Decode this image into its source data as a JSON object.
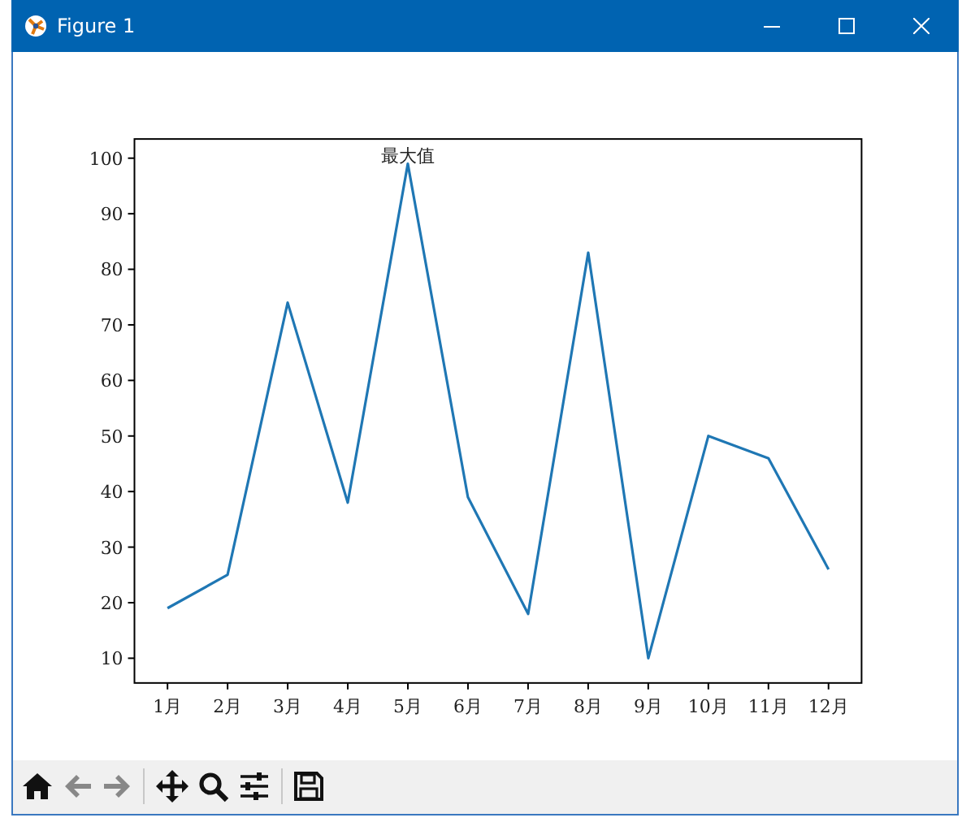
{
  "window": {
    "title": "Figure 1"
  },
  "chart_data": {
    "type": "line",
    "categories": [
      "1月",
      "2月",
      "3月",
      "4月",
      "5月",
      "6月",
      "7月",
      "8月",
      "9月",
      "10月",
      "11月",
      "12月"
    ],
    "series": [
      {
        "color": "#1f77b4",
        "values": [
          19,
          25,
          74,
          38,
          99,
          39,
          18,
          83,
          10,
          50,
          46,
          26
        ]
      }
    ],
    "ylim": [
      5.55,
      103.45
    ],
    "yticks": [
      10,
      20,
      30,
      40,
      50,
      60,
      70,
      80,
      90,
      100
    ],
    "annotations": [
      {
        "x": "5月",
        "y": 100,
        "text": "最大值"
      }
    ]
  },
  "toolbar": [
    {
      "buttons": [
        {
          "kind": "home",
          "disabled": false
        },
        {
          "kind": "back",
          "disabled": true
        },
        {
          "kind": "forward",
          "disabled": true
        }
      ]
    },
    {
      "buttons": [
        {
          "kind": "pan",
          "disabled": false
        },
        {
          "kind": "zoom",
          "disabled": false
        },
        {
          "kind": "configure",
          "disabled": false
        }
      ]
    },
    {
      "buttons": [
        {
          "kind": "save",
          "disabled": false
        }
      ]
    }
  ]
}
